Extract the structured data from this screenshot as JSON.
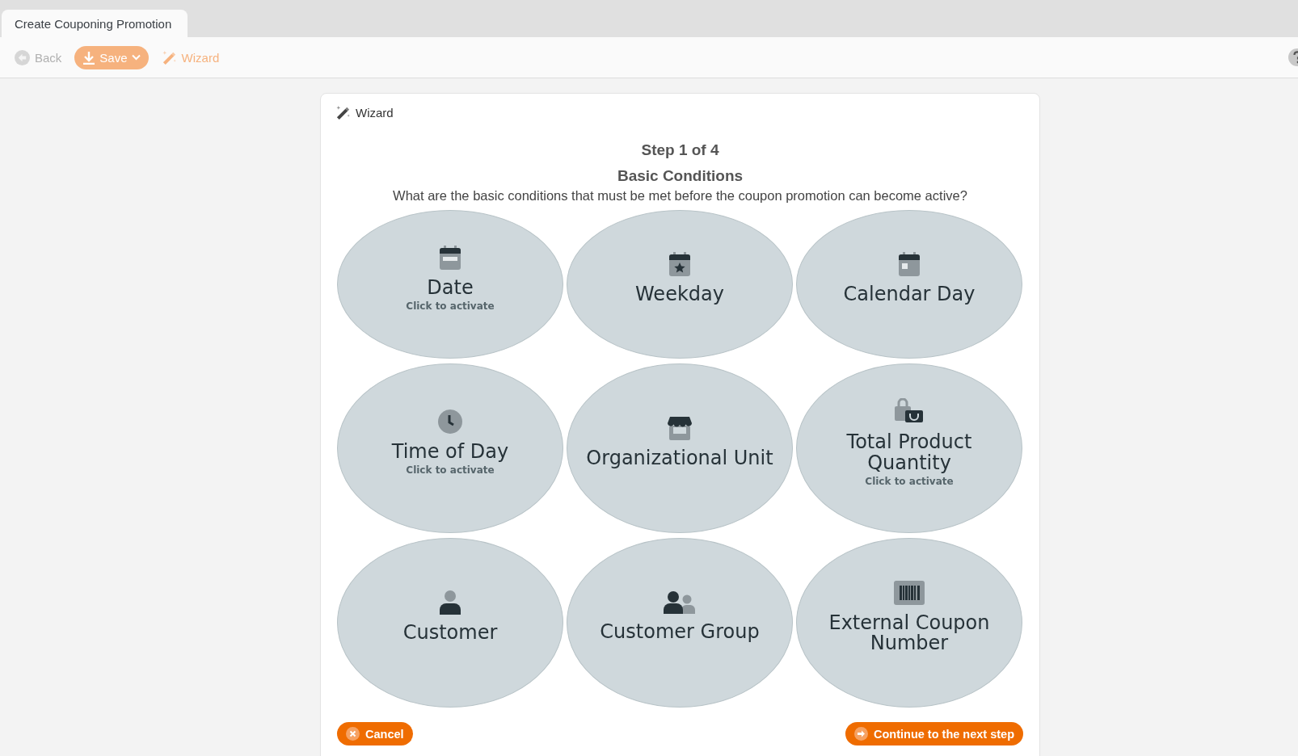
{
  "tabs": [
    {
      "label": "Create Couponing Promotion",
      "selected": true
    }
  ],
  "toolbar": [
    {
      "kind": "back",
      "label": "Back",
      "disabled": true
    },
    {
      "kind": "save",
      "label": "Save",
      "disabled": true
    },
    {
      "kind": "wizard",
      "label": "Wizard",
      "disabled": true
    }
  ],
  "wizard": {
    "title": "Wizard",
    "step": "Step 1 of 4",
    "heading": "Basic Conditions",
    "question": "What are the basic conditions that must be met before the coupon promotion can become active?",
    "options": [
      {
        "kind": "date",
        "label": "Date",
        "hint": "Click to activate"
      },
      {
        "kind": "weekday",
        "label": "Weekday"
      },
      {
        "kind": "calendar-day",
        "label": "Calendar Day"
      },
      {
        "kind": "time",
        "label": "Time of Day",
        "hint": "Click to activate"
      },
      {
        "kind": "org-unit",
        "label": "Organizational Unit"
      },
      {
        "kind": "quantity",
        "label": "Total Product Quantity",
        "hint": "Click to activate"
      },
      {
        "kind": "customer",
        "label": "Customer"
      },
      {
        "kind": "customer-group",
        "label": "Customer Group"
      },
      {
        "kind": "coupon-number",
        "label": "External Coupon Number"
      }
    ],
    "cancel": "Cancel",
    "next": "Continue to the next step"
  }
}
